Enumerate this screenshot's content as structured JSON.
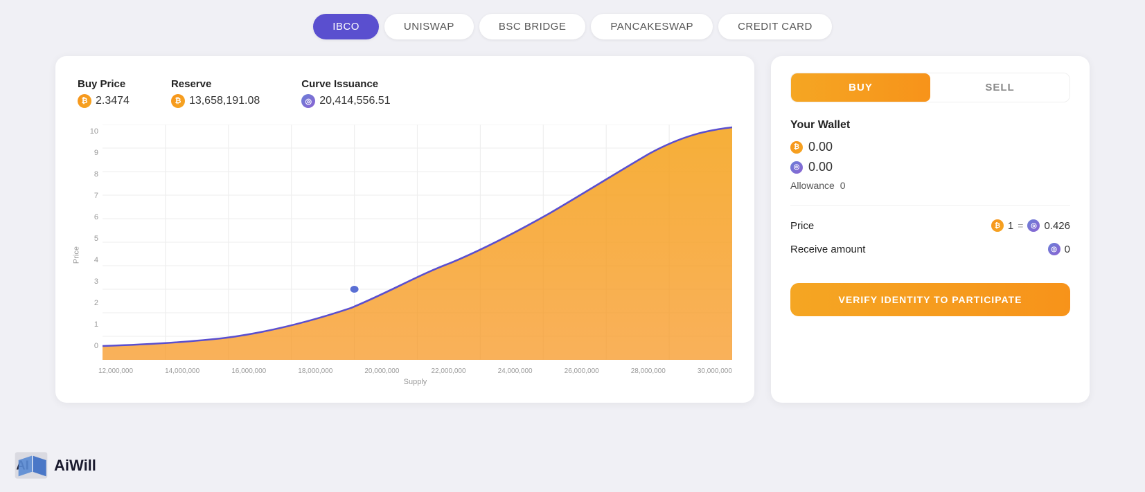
{
  "nav": {
    "tabs": [
      {
        "id": "ibco",
        "label": "IBCO",
        "active": true
      },
      {
        "id": "uniswap",
        "label": "UNISWAP",
        "active": false
      },
      {
        "id": "bsc-bridge",
        "label": "BSC BRIDGE",
        "active": false
      },
      {
        "id": "pancakeswap",
        "label": "PANCAKESWAP",
        "active": false
      },
      {
        "id": "credit-card",
        "label": "CREDIT CARD",
        "active": false
      }
    ]
  },
  "chart": {
    "stats": [
      {
        "label": "Buy Price",
        "value": "2.3474",
        "iconType": "orange"
      },
      {
        "label": "Reserve",
        "value": "13,658,191.08",
        "iconType": "orange"
      },
      {
        "label": "Curve Issuance",
        "value": "20,414,556.51",
        "iconType": "blue"
      }
    ],
    "yAxis": {
      "title": "Price",
      "labels": [
        "0",
        "1",
        "2",
        "3",
        "4",
        "5",
        "6",
        "7",
        "8",
        "9",
        "10"
      ]
    },
    "xAxis": {
      "title": "Supply",
      "labels": [
        "12,000,000",
        "14,000,000",
        "16,000,000",
        "18,000,000",
        "20,000,000",
        "22,000,000",
        "24,000,000",
        "26,000,000",
        "28,000,000",
        "30,000,000"
      ]
    }
  },
  "panel": {
    "buy_label": "BUY",
    "sell_label": "SELL",
    "wallet_title": "Your Wallet",
    "wallet_orange_value": "0.00",
    "wallet_blue_value": "0.00",
    "allowance_label": "Allowance",
    "allowance_value": "0",
    "price_label": "Price",
    "price_amount": "1",
    "price_equals": "=",
    "price_result": "0.426",
    "receive_label": "Receive amount",
    "receive_value": "0",
    "verify_button": "VERIFY IDENTITY TO PARTICIPATE"
  },
  "logo": {
    "text": "AiWill"
  }
}
